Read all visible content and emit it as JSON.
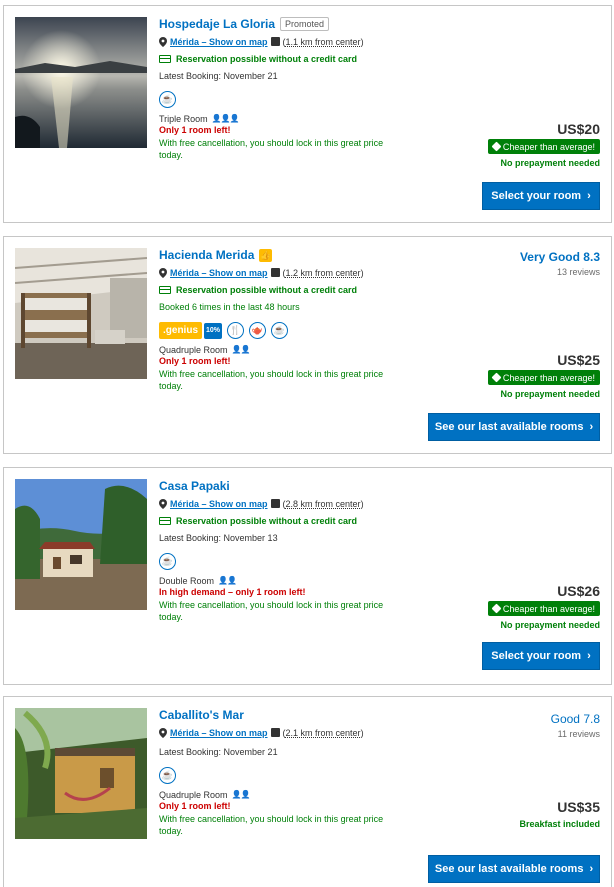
{
  "labels": {
    "show_on_map": "Show on map",
    "no_credit_card": "Reservation possible without a credit card",
    "cheaper": "Cheaper than average!",
    "no_prepayment": "No prepayment needed",
    "cancel_note": "With free cancellation, you should lock in this great price today."
  },
  "colors": {
    "brand_blue": "#0071c2",
    "green": "#008009",
    "warning_red": "#cc0000",
    "genius_yellow": "#febb02"
  },
  "hotels": [
    {
      "name": "Hospedaje La Gloria",
      "promoted": "Promoted",
      "city": "Mérida –",
      "distance": "1.1 km from center",
      "booking_note": "Latest Booking: November 21",
      "facilities": [
        "coffee-icon"
      ],
      "room": "Triple Room",
      "persons_icon": "three-persons-icon",
      "warning": "Only 1 room left!",
      "price": "US$20",
      "cta": "Select your room"
    },
    {
      "name": "Hacienda Merida",
      "badge_icon": "thumbs-up-icon",
      "city": "Mérida –",
      "distance": "1.2 km from center",
      "booking_note": "Booked 6 times in the last 48 hours",
      "genius": ".genius",
      "genius_discount": "10%",
      "facilities": [
        "restaurant-icon",
        "teapot-icon",
        "coffee-icon"
      ],
      "room": "Quadruple Room",
      "persons_icon": "two-persons-icon",
      "warning": "Only 1 room left!",
      "score": "Very Good 8.3",
      "reviews": "13 reviews",
      "price": "US$25",
      "cta": "See our last available rooms"
    },
    {
      "name": "Casa Papaki",
      "city": "Mérida –",
      "distance": "2.8 km from center",
      "booking_note": "Latest Booking: November 13",
      "facilities": [
        "coffee-icon"
      ],
      "room": "Double Room",
      "persons_icon": "two-persons-icon",
      "warning": "In high demand – only 1 room left!",
      "price": "US$26",
      "cta": "Select your room"
    },
    {
      "name": "Caballito's Mar",
      "city": "Mérida –",
      "distance": "2.1 km from center",
      "booking_note": "Latest Booking: November 21",
      "facilities": [
        "coffee-icon"
      ],
      "room": "Quadruple Room",
      "persons_icon": "two-persons-icon",
      "warning": "Only 1 room left!",
      "score": "Good 7.8",
      "reviews": "11 reviews",
      "price": "US$35",
      "breakfast": "Breakfast included",
      "cta": "See our last available rooms"
    }
  ]
}
